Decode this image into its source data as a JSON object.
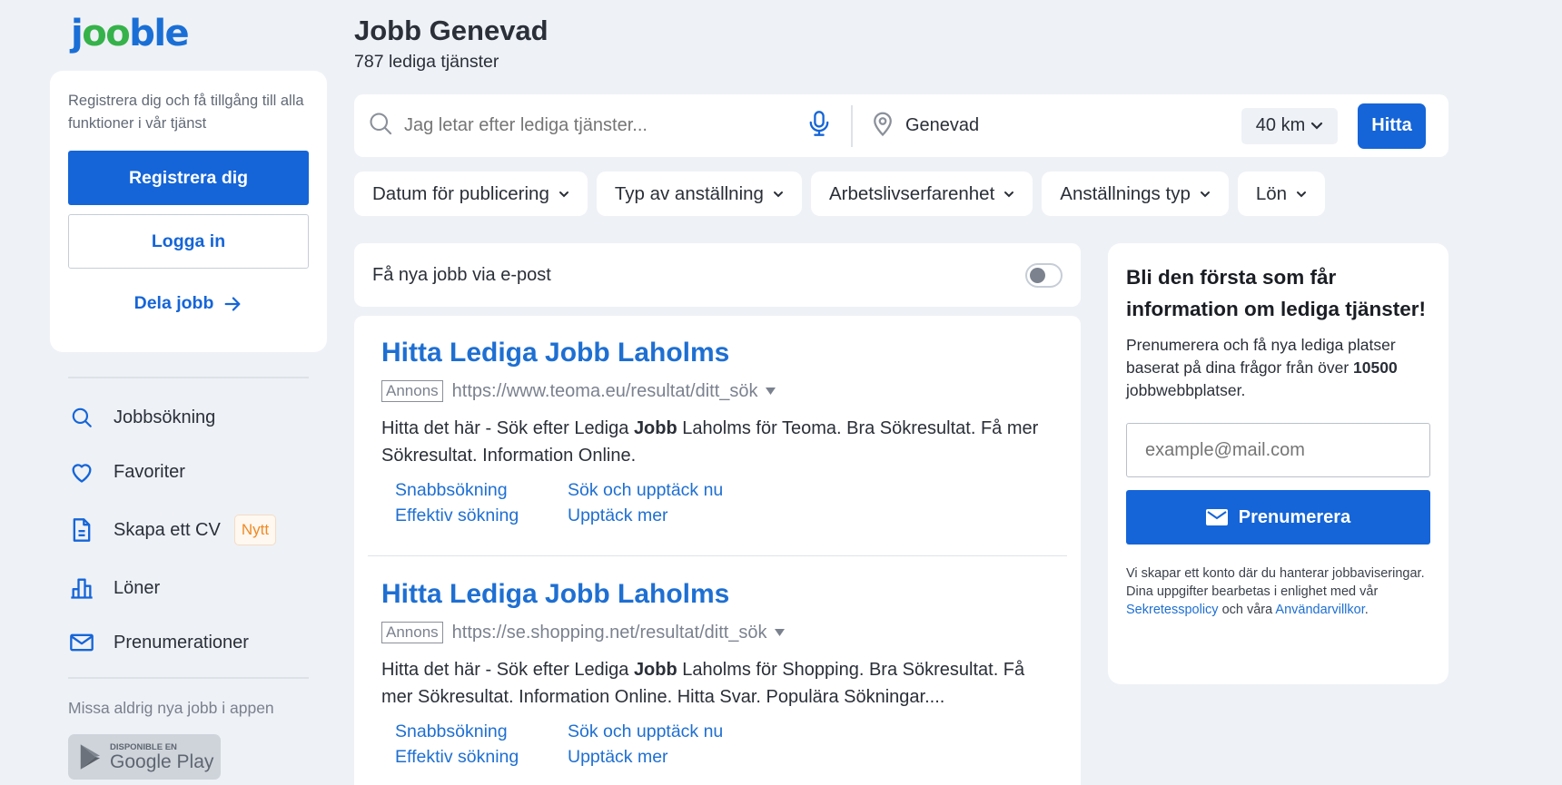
{
  "logo": {
    "j": "j",
    "oo": "oo",
    "ble": "ble"
  },
  "sidebar": {
    "register_text": "Registrera dig och få tillgång till alla funktioner i vår tjänst",
    "register_button": "Registrera dig",
    "login_button": "Logga in",
    "share_link": "Dela jobb",
    "nav": [
      {
        "label": "Jobbsökning",
        "icon": "search-icon"
      },
      {
        "label": "Favoriter",
        "icon": "heart-icon"
      },
      {
        "label": "Skapa ett CV",
        "icon": "document-icon",
        "badge": "Nytt"
      },
      {
        "label": "Löner",
        "icon": "bar-chart-icon"
      },
      {
        "label": "Prenumerationer",
        "icon": "mail-icon"
      }
    ],
    "app_text": "Missa aldrig nya jobb i appen",
    "google_play": {
      "small": "DISPONIBLE EN",
      "big": "Google Play"
    }
  },
  "header": {
    "title": "Jobb Genevad",
    "subtitle": "787 lediga tjänster"
  },
  "search": {
    "placeholder": "Jag letar efter lediga tjänster...",
    "location": "Genevad",
    "radius": "40 km",
    "find_button": "Hitta"
  },
  "filters": [
    "Datum för publicering",
    "Typ av anställning",
    "Arbetslivserfarenhet",
    "Anställnings typ",
    "Lön"
  ],
  "email_alert": {
    "label": "Få nya jobb via e-post",
    "enabled": false
  },
  "ads": [
    {
      "title": "Hitta Lediga Jobb Laholms",
      "badge": "Annons",
      "url": "https://www.teoma.eu/resultat/ditt_sök",
      "desc_pre": "Hitta det här - Sök efter Lediga ",
      "desc_bold": "Jobb",
      "desc_post": " Laholms för Teoma. Bra Sökresultat. Få mer Sökresultat. Information Online.",
      "links": [
        "Snabbsökning",
        "Sök och upptäck nu",
        "Effektiv sökning",
        "Upptäck mer"
      ]
    },
    {
      "title": "Hitta Lediga Jobb Laholms",
      "badge": "Annons",
      "url": "https://se.shopping.net/resultat/ditt_sök",
      "desc_pre": "Hitta det här - Sök efter Lediga ",
      "desc_bold": "Jobb",
      "desc_post": " Laholms för Shopping. Bra Sökresultat. Få mer Sökresultat. Information Online. Hitta Svar. Populära Sökningar....",
      "links": [
        "Snabbsökning",
        "Sök och upptäck nu",
        "Effektiv sökning",
        "Upptäck mer"
      ]
    }
  ],
  "subscribe": {
    "title": "Bli den första som får information om lediga tjänster!",
    "text_pre": "Prenumerera och få nya lediga platser baserat på dina frågor från över ",
    "text_bold": "10500",
    "text_post": " jobbwebbplatser.",
    "email_placeholder": "example@mail.com",
    "button": "Prenumerera",
    "legal_pre": "Vi skapar ett konto där du hanterar jobbaviseringar. Dina uppgifter bearbetas i enlighet med vår ",
    "legal_link1": "Sekretesspolicy",
    "legal_mid": " och våra ",
    "legal_link2": "Användarvillkor",
    "legal_end": "."
  },
  "colors": {
    "primary": "#1565d8",
    "link": "#1e6fd2",
    "logo_green": "#36b24a",
    "background": "#eef1f6"
  }
}
